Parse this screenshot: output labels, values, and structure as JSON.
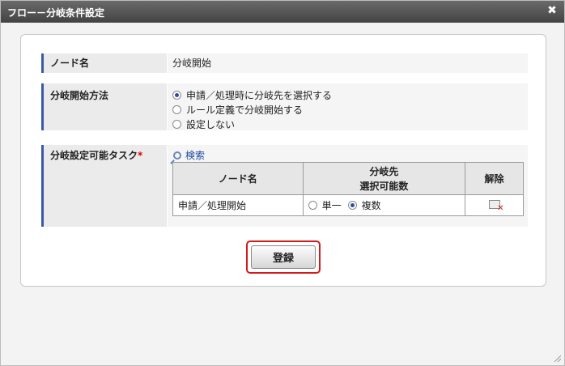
{
  "dialog": {
    "title": "フロー－分岐条件設定",
    "close_glyph": "✖"
  },
  "node_name_row": {
    "label": "ノード名",
    "value": "分岐開始"
  },
  "branch_method_row": {
    "label": "分岐開始方法",
    "options": [
      {
        "label": "申請／処理時に分岐先を選択する",
        "selected": true
      },
      {
        "label": "ルール定義で分岐開始する",
        "selected": false
      },
      {
        "label": "設定しない",
        "selected": false
      }
    ]
  },
  "task_row": {
    "label": "分岐設定可能タスク",
    "required_mark": "*",
    "search_label": "検索",
    "table": {
      "headers": {
        "node_name": "ノード名",
        "branch_line1": "分岐先",
        "branch_line2": "選択可能数",
        "release": "解除"
      },
      "rows": [
        {
          "node_name": "申請／処理開始",
          "single_label": "単一",
          "multiple_label": "複数",
          "selected": "multiple"
        }
      ]
    }
  },
  "register_button": {
    "label": "登録"
  },
  "colors": {
    "accent": "#3a5aa8",
    "highlight": "#d41a1a",
    "titlebar": "#4a4a4a"
  }
}
